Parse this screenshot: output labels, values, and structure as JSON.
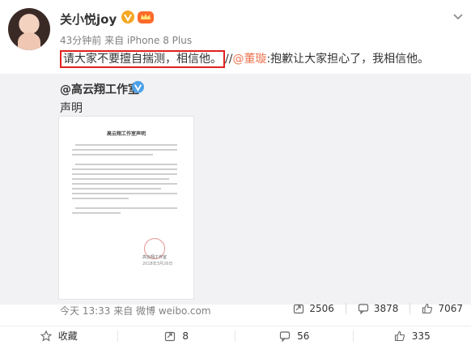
{
  "post": {
    "username": "关小悦joy",
    "meta": "43分钟前 来自 iPhone 8 Plus",
    "highlighted_text": "请大家不要擅自揣测，相信他。",
    "separator": "//",
    "mention": "@董璇",
    "rest_text": ":抱歉让大家担心了，我相信他。",
    "icons": [
      "vip-v-icon",
      "member-crown-icon",
      "chevron-down-icon"
    ]
  },
  "repost": {
    "author": "@高云翔工作室",
    "text": "声明",
    "doc_title": "高云翔工作室声明",
    "doc_sign": "高云翔工作室",
    "doc_date": "2018年3月26日",
    "time": "今天 13:33 来自 微博 weibo.com",
    "stats": {
      "reposts": "2506",
      "comments": "3878",
      "likes": "7067"
    }
  },
  "actions": {
    "favorite": "收藏",
    "repost": "8",
    "comment": "56",
    "like": "335"
  },
  "colors": {
    "mention": "#eb7350",
    "highlight_border": "#e02020",
    "vip": "#f5a623",
    "repost_bg": "#f2f2f5"
  }
}
